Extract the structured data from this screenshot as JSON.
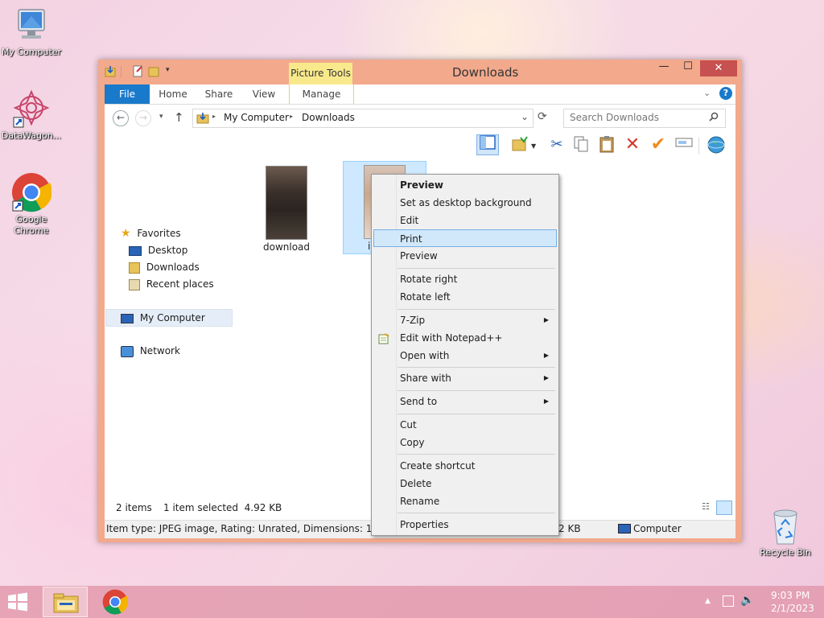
{
  "desktop": {
    "icons": [
      {
        "label": "My Computer",
        "icon": "computer-icon"
      },
      {
        "label": "DataWagon...",
        "icon": "datawagon-icon"
      },
      {
        "label": "Google Chrome",
        "icon": "chrome-icon"
      },
      {
        "label": "Recycle Bin",
        "icon": "recycle-bin-icon"
      }
    ]
  },
  "window": {
    "title": "Downloads",
    "contextual_group": "Picture Tools",
    "tabs": [
      "File",
      "Home",
      "Share",
      "View",
      "Manage"
    ],
    "controls": {
      "minimize": "—",
      "maximize": "☐",
      "close": "✕"
    },
    "help": "?"
  },
  "address": {
    "breadcrumb": [
      "My Computer",
      "Downloads"
    ],
    "search_placeholder": "Search Downloads"
  },
  "nav_pane": {
    "favorites": "Favorites",
    "favorite_items": [
      "Desktop",
      "Downloads",
      "Recent places"
    ],
    "my_computer": "My Computer",
    "network": "Network"
  },
  "files": [
    {
      "name": "download"
    },
    {
      "name": "i"
    }
  ],
  "status": {
    "items": "2 items",
    "selected": "1 item selected  4.92 KB",
    "details": "Item type: JPEG image, Rating: Unrated, Dimensions: 165 x 305,",
    "size": "2 KB",
    "location": "Computer"
  },
  "context_menu": {
    "items": [
      {
        "label": "Preview",
        "bold": true
      },
      {
        "label": "Set as desktop background"
      },
      {
        "label": "Edit"
      },
      {
        "label": "Print",
        "highlighted": true
      },
      {
        "label": "Preview"
      },
      {
        "label": "Rotate right"
      },
      {
        "label": "Rotate left"
      },
      {
        "label": "7-Zip",
        "submenu": true
      },
      {
        "label": "Edit with Notepad++",
        "icon": "notepad-plus-icon"
      },
      {
        "label": "Open with",
        "submenu": true
      },
      {
        "label": "Share with",
        "submenu": true
      },
      {
        "label": "Send to",
        "submenu": true
      },
      {
        "label": "Cut"
      },
      {
        "label": "Copy"
      },
      {
        "label": "Create shortcut"
      },
      {
        "label": "Delete"
      },
      {
        "label": "Rename"
      },
      {
        "label": "Properties"
      }
    ]
  },
  "taskbar": {
    "time": "9:03 PM",
    "date": "2/1/2023"
  },
  "colors": {
    "file_tab": "#1979ca",
    "context_tab": "#f8e98c",
    "window_frame": "#f2a98c",
    "close_button": "#c75050",
    "highlight": "#d1e8fb"
  }
}
